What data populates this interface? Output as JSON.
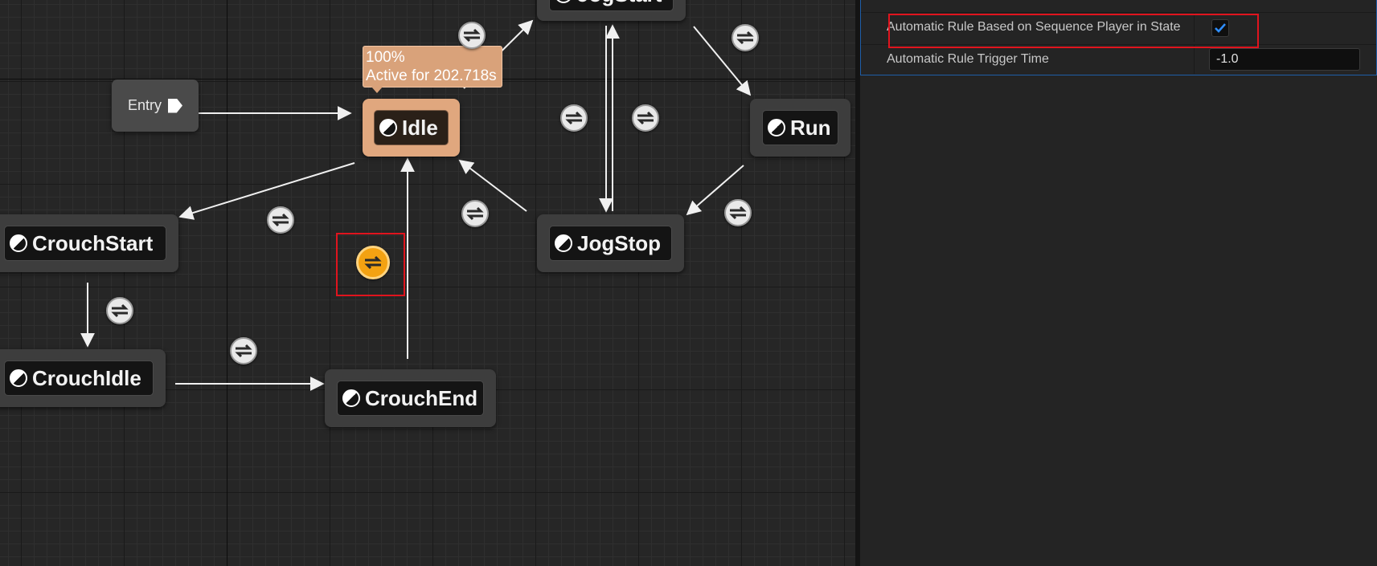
{
  "graph": {
    "entry_label": "Entry",
    "active_tooltip": {
      "percent": "100%",
      "active_text": "Active for 202.718s"
    },
    "states": {
      "jogstart": "JogStart",
      "idle": "Idle",
      "run": "Run",
      "crouch_start": "CrouchStart",
      "jog_stop": "JogStop",
      "crouch_idle": "CrouchIdle",
      "crouch_end": "CrouchEnd"
    },
    "selected_transition": "CrouchEnd to Idle",
    "highlight_color": "#e0141e",
    "active_state_color": "#e0a77e",
    "selected_transition_color": "#f3a212"
  },
  "details": {
    "rows": [
      {
        "label": "Automatic Rule Based on Sequence Player in State",
        "checked": true
      },
      {
        "label": "Automatic Rule Trigger Time",
        "value": "-1.0"
      }
    ],
    "checkbox_color": "#2f8fff"
  }
}
